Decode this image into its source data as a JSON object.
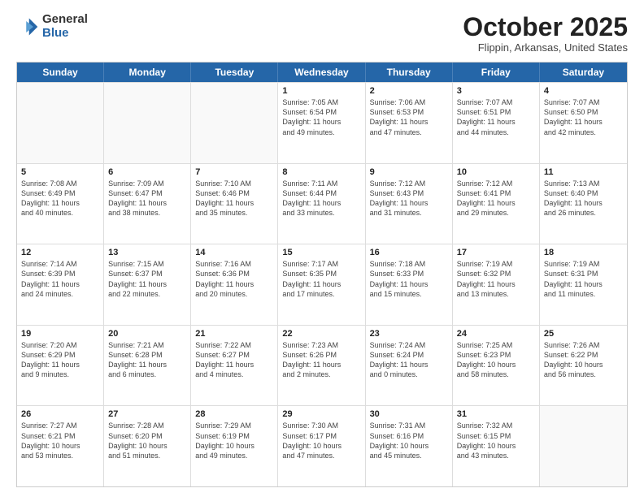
{
  "logo": {
    "general": "General",
    "blue": "Blue"
  },
  "title": "October 2025",
  "subtitle": "Flippin, Arkansas, United States",
  "headers": [
    "Sunday",
    "Monday",
    "Tuesday",
    "Wednesday",
    "Thursday",
    "Friday",
    "Saturday"
  ],
  "rows": [
    [
      {
        "day": "",
        "info": ""
      },
      {
        "day": "",
        "info": ""
      },
      {
        "day": "",
        "info": ""
      },
      {
        "day": "1",
        "info": "Sunrise: 7:05 AM\nSunset: 6:54 PM\nDaylight: 11 hours\nand 49 minutes."
      },
      {
        "day": "2",
        "info": "Sunrise: 7:06 AM\nSunset: 6:53 PM\nDaylight: 11 hours\nand 47 minutes."
      },
      {
        "day": "3",
        "info": "Sunrise: 7:07 AM\nSunset: 6:51 PM\nDaylight: 11 hours\nand 44 minutes."
      },
      {
        "day": "4",
        "info": "Sunrise: 7:07 AM\nSunset: 6:50 PM\nDaylight: 11 hours\nand 42 minutes."
      }
    ],
    [
      {
        "day": "5",
        "info": "Sunrise: 7:08 AM\nSunset: 6:49 PM\nDaylight: 11 hours\nand 40 minutes."
      },
      {
        "day": "6",
        "info": "Sunrise: 7:09 AM\nSunset: 6:47 PM\nDaylight: 11 hours\nand 38 minutes."
      },
      {
        "day": "7",
        "info": "Sunrise: 7:10 AM\nSunset: 6:46 PM\nDaylight: 11 hours\nand 35 minutes."
      },
      {
        "day": "8",
        "info": "Sunrise: 7:11 AM\nSunset: 6:44 PM\nDaylight: 11 hours\nand 33 minutes."
      },
      {
        "day": "9",
        "info": "Sunrise: 7:12 AM\nSunset: 6:43 PM\nDaylight: 11 hours\nand 31 minutes."
      },
      {
        "day": "10",
        "info": "Sunrise: 7:12 AM\nSunset: 6:41 PM\nDaylight: 11 hours\nand 29 minutes."
      },
      {
        "day": "11",
        "info": "Sunrise: 7:13 AM\nSunset: 6:40 PM\nDaylight: 11 hours\nand 26 minutes."
      }
    ],
    [
      {
        "day": "12",
        "info": "Sunrise: 7:14 AM\nSunset: 6:39 PM\nDaylight: 11 hours\nand 24 minutes."
      },
      {
        "day": "13",
        "info": "Sunrise: 7:15 AM\nSunset: 6:37 PM\nDaylight: 11 hours\nand 22 minutes."
      },
      {
        "day": "14",
        "info": "Sunrise: 7:16 AM\nSunset: 6:36 PM\nDaylight: 11 hours\nand 20 minutes."
      },
      {
        "day": "15",
        "info": "Sunrise: 7:17 AM\nSunset: 6:35 PM\nDaylight: 11 hours\nand 17 minutes."
      },
      {
        "day": "16",
        "info": "Sunrise: 7:18 AM\nSunset: 6:33 PM\nDaylight: 11 hours\nand 15 minutes."
      },
      {
        "day": "17",
        "info": "Sunrise: 7:19 AM\nSunset: 6:32 PM\nDaylight: 11 hours\nand 13 minutes."
      },
      {
        "day": "18",
        "info": "Sunrise: 7:19 AM\nSunset: 6:31 PM\nDaylight: 11 hours\nand 11 minutes."
      }
    ],
    [
      {
        "day": "19",
        "info": "Sunrise: 7:20 AM\nSunset: 6:29 PM\nDaylight: 11 hours\nand 9 minutes."
      },
      {
        "day": "20",
        "info": "Sunrise: 7:21 AM\nSunset: 6:28 PM\nDaylight: 11 hours\nand 6 minutes."
      },
      {
        "day": "21",
        "info": "Sunrise: 7:22 AM\nSunset: 6:27 PM\nDaylight: 11 hours\nand 4 minutes."
      },
      {
        "day": "22",
        "info": "Sunrise: 7:23 AM\nSunset: 6:26 PM\nDaylight: 11 hours\nand 2 minutes."
      },
      {
        "day": "23",
        "info": "Sunrise: 7:24 AM\nSunset: 6:24 PM\nDaylight: 11 hours\nand 0 minutes."
      },
      {
        "day": "24",
        "info": "Sunrise: 7:25 AM\nSunset: 6:23 PM\nDaylight: 10 hours\nand 58 minutes."
      },
      {
        "day": "25",
        "info": "Sunrise: 7:26 AM\nSunset: 6:22 PM\nDaylight: 10 hours\nand 56 minutes."
      }
    ],
    [
      {
        "day": "26",
        "info": "Sunrise: 7:27 AM\nSunset: 6:21 PM\nDaylight: 10 hours\nand 53 minutes."
      },
      {
        "day": "27",
        "info": "Sunrise: 7:28 AM\nSunset: 6:20 PM\nDaylight: 10 hours\nand 51 minutes."
      },
      {
        "day": "28",
        "info": "Sunrise: 7:29 AM\nSunset: 6:19 PM\nDaylight: 10 hours\nand 49 minutes."
      },
      {
        "day": "29",
        "info": "Sunrise: 7:30 AM\nSunset: 6:17 PM\nDaylight: 10 hours\nand 47 minutes."
      },
      {
        "day": "30",
        "info": "Sunrise: 7:31 AM\nSunset: 6:16 PM\nDaylight: 10 hours\nand 45 minutes."
      },
      {
        "day": "31",
        "info": "Sunrise: 7:32 AM\nSunset: 6:15 PM\nDaylight: 10 hours\nand 43 minutes."
      },
      {
        "day": "",
        "info": ""
      }
    ]
  ]
}
